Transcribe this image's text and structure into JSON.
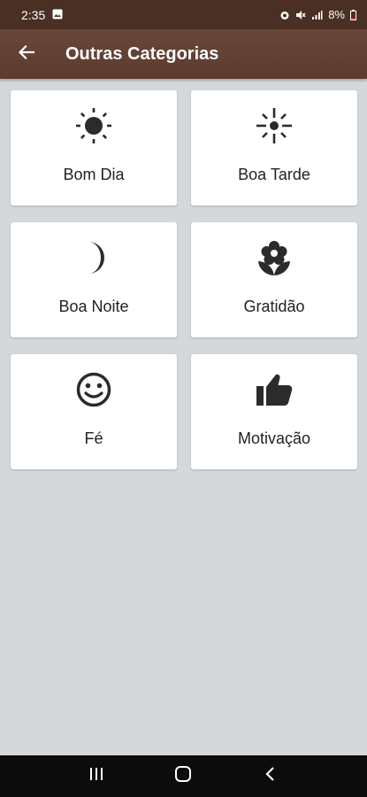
{
  "status_bar": {
    "time": "2:35",
    "battery": "8%"
  },
  "app_bar": {
    "title": "Outras Categorias",
    "back_icon": "arrow-left-icon"
  },
  "categories": [
    {
      "label": "Bom Dia",
      "icon": "sun-icon"
    },
    {
      "label": "Boa Tarde",
      "icon": "sun-rays-icon"
    },
    {
      "label": "Boa Noite",
      "icon": "moon-icon"
    },
    {
      "label": "Gratidão",
      "icon": "flower-icon"
    },
    {
      "label": "Fé",
      "icon": "smiley-icon"
    },
    {
      "label": "Motivação",
      "icon": "thumbs-up-icon"
    }
  ],
  "nav_bar": {
    "icons": [
      "recent-apps-icon",
      "home-icon",
      "back-icon"
    ]
  },
  "colors": {
    "status_bar": "#4a2f24",
    "app_bar": "#5c3c2f",
    "background": "#d4d8db",
    "card": "#ffffff",
    "icon": "#2b2b2b"
  }
}
